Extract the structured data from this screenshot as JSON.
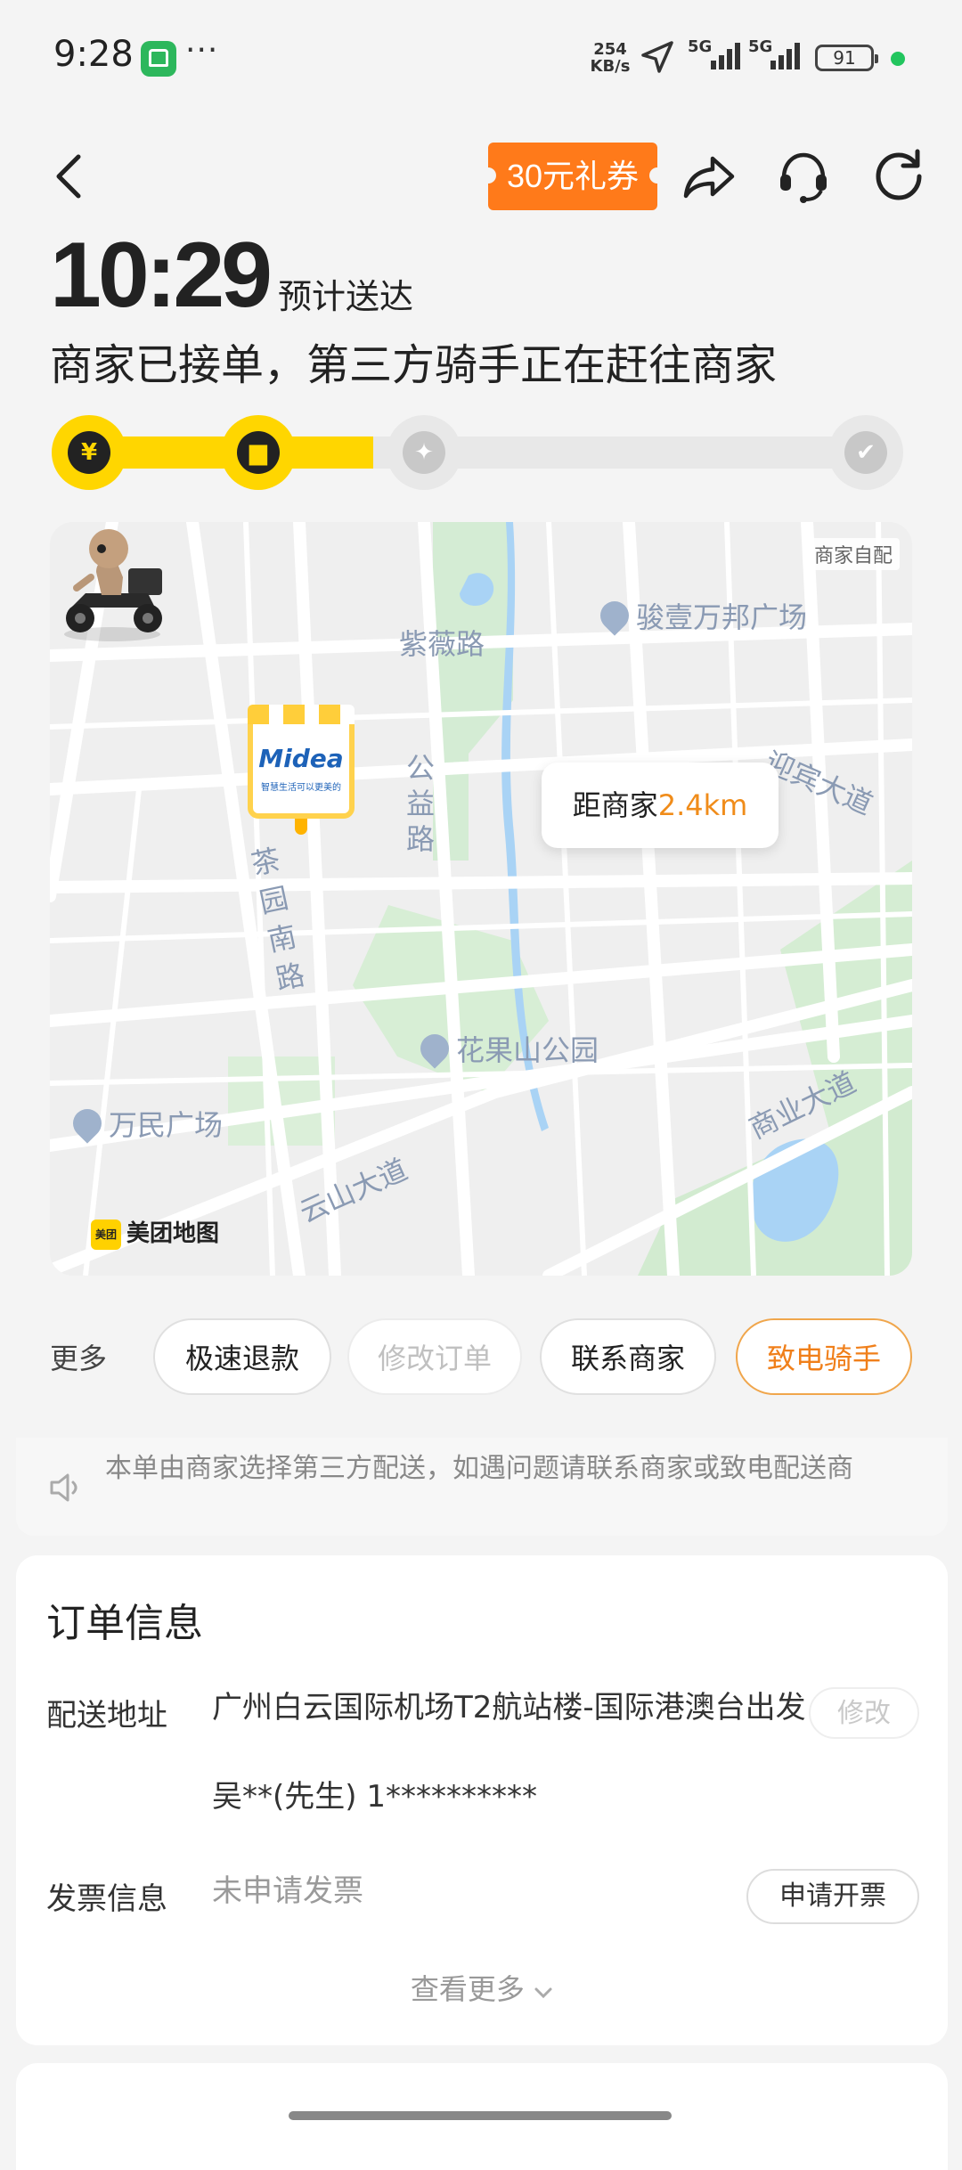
{
  "status_bar": {
    "time": "9:28",
    "more": "···",
    "net_speed_value": "254",
    "net_speed_unit": "KB/s",
    "network1": "5G",
    "network2": "5G",
    "battery": "91",
    "app_icon": "app-icon"
  },
  "top_bar": {
    "coupon": "30元礼券",
    "icons": [
      "back-icon",
      "share-icon",
      "customer-service-icon",
      "refresh-icon"
    ]
  },
  "eta": {
    "time": "10:29",
    "label": "预计送达"
  },
  "status_message": "商家已接单，第三方骑手正在赶往商家",
  "progress": {
    "fill_fraction": 0.36,
    "steps": [
      {
        "name": "paid",
        "icon": "yen-icon",
        "glyph": "¥",
        "done": true
      },
      {
        "name": "merchant",
        "icon": "store-icon",
        "glyph": "▆",
        "done": true
      },
      {
        "name": "delivering",
        "icon": "scooter-icon",
        "glyph": "✦",
        "done": false
      },
      {
        "name": "delivered",
        "icon": "check-icon",
        "glyph": "✔",
        "done": false
      }
    ]
  },
  "map": {
    "self_pickup": "商家自配",
    "labels": {
      "ziwei": "紫薇路",
      "junyi": "骏壹万邦广场",
      "yingbin": "迎宾大道",
      "gongyi": "公益路",
      "chayuan": "茶园南路",
      "huaguoshan": "花果山公园",
      "wanmin": "万民广场",
      "yunshan": "云山大道",
      "shangye": "商业大道"
    },
    "merchant": {
      "name": "Midea",
      "slogan": "智慧生活可以更美的"
    },
    "distance": {
      "label": "距商家",
      "value": "2.4km"
    },
    "logo_badge": "美团",
    "logo_text": "美团地图"
  },
  "actions": {
    "more": "更多",
    "buttons": {
      "refund": "极速退款",
      "modify": "修改订单",
      "contact_merchant": "联系商家",
      "call_rider": "致电骑手"
    }
  },
  "notice": {
    "icon": "speaker-icon",
    "text": "本单由商家选择第三方配送，如遇问题请联系商家或致电配送商"
  },
  "order_info": {
    "title": "订单信息",
    "address_label": "配送地址",
    "address": "广州白云国际机场T2航站楼-国际港澳台出发",
    "contact": "吴**(先生) 1**********",
    "edit_button": "修改",
    "invoice_label": "发票信息",
    "invoice_value": "未申请发票",
    "invoice_button": "申请开票",
    "see_more": "查看更多"
  },
  "colors": {
    "accent_yellow": "#ffd600",
    "accent_orange": "#f07f1a",
    "coupon": "#ff7a1a"
  }
}
